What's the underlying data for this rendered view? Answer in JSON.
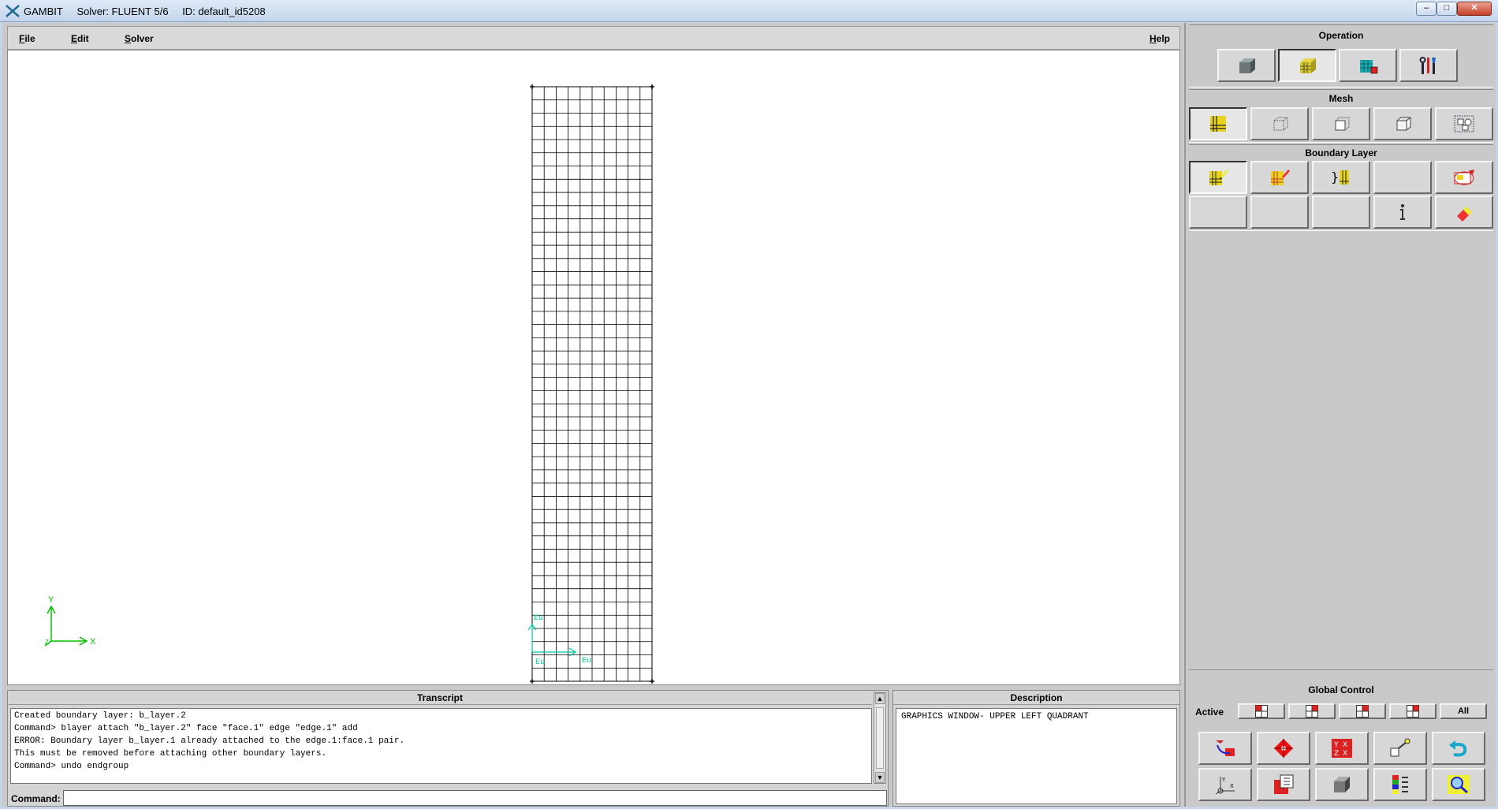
{
  "window": {
    "app_name": "GAMBIT",
    "solver": "Solver: FLUENT 5/6",
    "id": "ID: default_id5208",
    "controls": [
      "minimize",
      "maximize",
      "close"
    ]
  },
  "menu": {
    "file": "File",
    "edit": "Edit",
    "solver": "Solver",
    "help": "Help"
  },
  "graphics": {
    "axis_y": "Y",
    "axis_x": "X",
    "axis_z": "Z",
    "mesh_cols": 10,
    "mesh_rows": 45,
    "label_bl1": "Eu",
    "label_bl2": "Eu",
    "label_bl3": "Eu"
  },
  "transcript": {
    "title": "Transcript",
    "lines": [
      "Created boundary layer: b_layer.2",
      "Command> blayer attach \"b_layer.2\" face \"face.1\" edge \"edge.1\" add",
      "ERROR: Boundary layer b_layer.1 already attached to the edge.1:face.1 pair.",
      "This must be removed before attaching other boundary layers.",
      "Command> undo endgroup"
    ],
    "command_label": "Command:",
    "command_value": ""
  },
  "description": {
    "title": "Description",
    "text": "GRAPHICS WINDOW- UPPER LEFT QUADRANT"
  },
  "panel": {
    "operation": {
      "title": "Operation",
      "buttons": [
        "geometry-icon",
        "mesh-icon",
        "zones-icon",
        "tools-icon"
      ],
      "selected": 1
    },
    "mesh": {
      "title": "Mesh",
      "buttons": [
        "boundary-layer-icon",
        "edge-icon",
        "face-icon",
        "volume-icon",
        "group-icon"
      ],
      "selected": 0
    },
    "boundary_layer": {
      "title": "Boundary Layer",
      "row1": [
        "create-boundary-layer-icon",
        "modify-boundary-layer-icon",
        "link-boundary-layer-icon",
        "blank",
        "summarize-icon"
      ],
      "row2": [
        "blank",
        "blank",
        "blank",
        "info-icon",
        "delete-icon"
      ],
      "selected": 0
    },
    "global_control": {
      "title": "Global Control",
      "active_label": "Active",
      "quadrants": [
        "upper-left-quadrant-icon",
        "upper-right-quadrant-icon",
        "lower-left-quadrant-icon",
        "lower-right-quadrant-icon"
      ],
      "all_label": "All",
      "row1": [
        "fit-to-window-icon",
        "select-pivot-icon",
        "orient-model-icon",
        "modify-lights-icon",
        "undo-icon"
      ],
      "row2": [
        "specify-display-icon",
        "render-model-icon",
        "shade-icon",
        "color-legend-icon",
        "zoom-icon"
      ]
    }
  }
}
